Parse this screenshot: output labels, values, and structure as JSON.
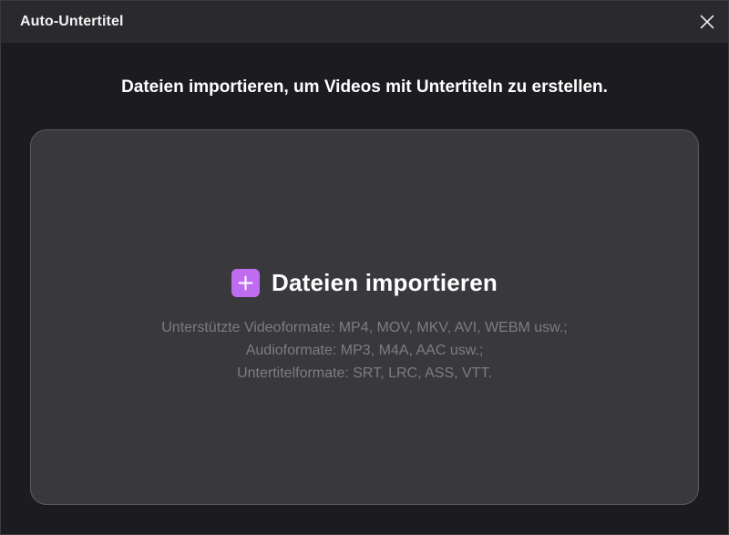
{
  "window": {
    "title": "Auto-Untertitel",
    "close_icon": "close-icon"
  },
  "main": {
    "heading": "Dateien importieren, um Videos mit Untertiteln zu erstellen.",
    "dropzone": {
      "icon": "plus-icon",
      "import_label": "Dateien importieren",
      "formats": [
        "Unterstützte Videoformate: MP4, MOV, MKV, AVI, WEBM usw.;",
        "Audioformate: MP3, M4A, AAC usw.;",
        "Untertitelformate: SRT, LRC, ASS, VTT."
      ]
    }
  },
  "colors": {
    "accent": "#c06cf0",
    "background": "#1c1c20",
    "titlebar": "#2a2a2e",
    "dropzone": "#38383d",
    "muted_text": "#7c7c82"
  }
}
